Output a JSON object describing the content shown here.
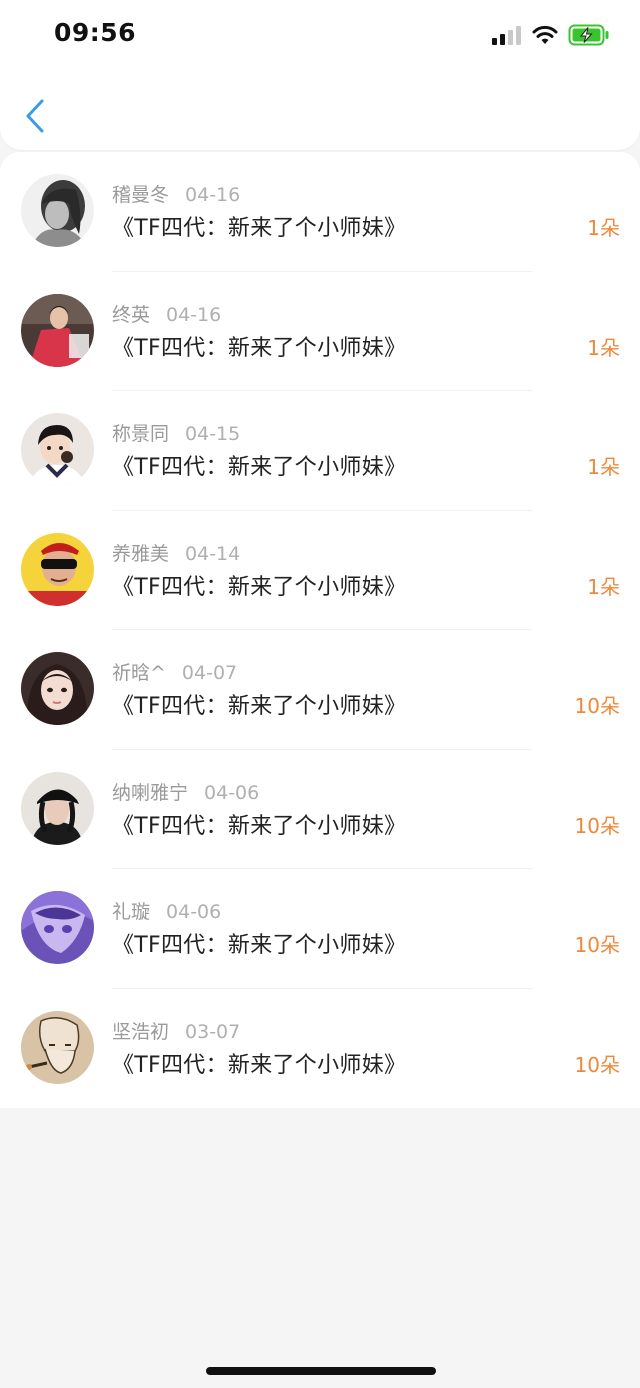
{
  "status_bar": {
    "time": "09:56"
  },
  "nav": {
    "back_icon": "chevron-left-icon",
    "accent_color": "#3a9be8"
  },
  "colors": {
    "amount": "#f0883a",
    "name": "#9a9a9a",
    "title": "#222222",
    "battery": "#39c42f"
  },
  "items": [
    {
      "name": "稽曼冬",
      "date": "04-16",
      "title": "《TF四代：新来了个小师妹》",
      "amount": "1朵"
    },
    {
      "name": "终英",
      "date": "04-16",
      "title": "《TF四代：新来了个小师妹》",
      "amount": "1朵"
    },
    {
      "name": "称景同",
      "date": "04-15",
      "title": "《TF四代：新来了个小师妹》",
      "amount": "1朵"
    },
    {
      "name": "养雅美",
      "date": "04-14",
      "title": "《TF四代：新来了个小师妹》",
      "amount": "1朵"
    },
    {
      "name": "祈晗^",
      "date": "04-07",
      "title": "《TF四代：新来了个小师妹》",
      "amount": "10朵"
    },
    {
      "name": "纳喇雅宁",
      "date": "04-06",
      "title": "《TF四代：新来了个小师妹》",
      "amount": "10朵"
    },
    {
      "name": "礼璇",
      "date": "04-06",
      "title": "《TF四代：新来了个小师妹》",
      "amount": "10朵"
    },
    {
      "name": "坚浩初",
      "date": "03-07",
      "title": "《TF四代：新来了个小师妹》",
      "amount": "10朵"
    }
  ]
}
